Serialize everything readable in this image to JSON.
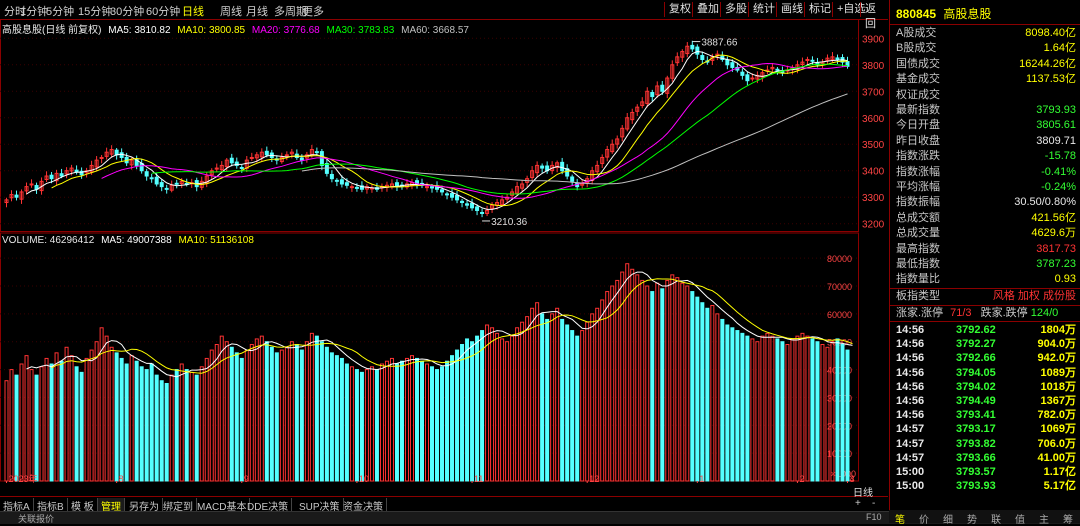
{
  "toolbar": {
    "periods": [
      "分时",
      "1分钟",
      "5分钟",
      "15分钟",
      "30分钟",
      "60分钟",
      "日线",
      "周线",
      "月线",
      "多周期",
      "更多"
    ],
    "active_period": "日线",
    "right_buttons": [
      "复权",
      "叠加",
      "多股",
      "统计",
      "画线",
      "标记",
      "+自选",
      "返回"
    ]
  },
  "price_legend": {
    "title": "高股息股(日线 前复权)",
    "ma5": "MA5: 3810.82",
    "ma10": "MA10: 3800.85",
    "ma20": "MA20: 3776.68",
    "ma30": "MA30: 3783.83",
    "ma60": "MA60: 3668.57"
  },
  "volume_legend": {
    "volume": "VOLUME: 46296412",
    "ma5": "MA5: 49007388",
    "ma10": "MA10: 51136108"
  },
  "colors": {
    "up": "#ff3333",
    "down": "#54ffff",
    "ma5": "#ffffff",
    "ma10": "#ffff00",
    "ma20": "#ff00ff",
    "ma30": "#00ff00",
    "ma60": "#c0c0c0",
    "frame": "#8b0000"
  },
  "chart_data": {
    "type": "candlestick",
    "price_axis": {
      "ticks": [
        3200,
        3300,
        3400,
        3500,
        3600,
        3700,
        3800,
        3900
      ],
      "ylim": [
        3180,
        3920
      ]
    },
    "volume_axis": {
      "ticks": [
        10000,
        20000,
        30000,
        40000,
        50000,
        60000,
        70000,
        80000
      ],
      "ylim": [
        0,
        84000
      ],
      "unit": "×1000"
    },
    "x_labels": [
      "2023年",
      "8",
      "9",
      "10",
      "11",
      "12",
      "1",
      "2",
      "3",
      "4"
    ],
    "annotations": [
      {
        "label": "3887.66",
        "x_index": 137,
        "value": 3887.66
      },
      {
        "label": "3210.36",
        "x_index": 95,
        "value": 3210.36
      }
    ],
    "close": [
      3290,
      3310,
      3300,
      3320,
      3340,
      3350,
      3330,
      3360,
      3380,
      3370,
      3390,
      3380,
      3400,
      3410,
      3395,
      3385,
      3400,
      3420,
      3440,
      3450,
      3470,
      3480,
      3460,
      3450,
      3430,
      3440,
      3420,
      3400,
      3380,
      3370,
      3350,
      3340,
      3330,
      3345,
      3350,
      3360,
      3350,
      3355,
      3340,
      3360,
      3380,
      3400,
      3410,
      3420,
      3440,
      3430,
      3420,
      3410,
      3440,
      3450,
      3460,
      3470,
      3460,
      3450,
      3440,
      3450,
      3460,
      3470,
      3450,
      3440,
      3460,
      3480,
      3470,
      3420,
      3390,
      3370,
      3360,
      3350,
      3345,
      3340,
      3335,
      3330,
      3340,
      3335,
      3330,
      3340,
      3345,
      3350,
      3340,
      3345,
      3350,
      3355,
      3350,
      3345,
      3340,
      3335,
      3330,
      3320,
      3310,
      3300,
      3290,
      3280,
      3270,
      3260,
      3250,
      3240,
      3250,
      3270,
      3280,
      3290,
      3300,
      3320,
      3340,
      3350,
      3370,
      3400,
      3420,
      3410,
      3400,
      3420,
      3430,
      3400,
      3380,
      3360,
      3340,
      3350,
      3370,
      3400,
      3420,
      3450,
      3480,
      3500,
      3520,
      3560,
      3600,
      3620,
      3640,
      3660,
      3700,
      3680,
      3720,
      3700,
      3750,
      3800,
      3830,
      3850,
      3870,
      3860,
      3840,
      3820,
      3810,
      3830,
      3840,
      3820,
      3800,
      3790,
      3780,
      3760,
      3740,
      3750,
      3760,
      3770,
      3780,
      3790,
      3780,
      3770,
      3780,
      3790,
      3800,
      3810,
      3820,
      3815,
      3800,
      3810,
      3825,
      3830,
      3820,
      3810,
      3794
    ],
    "volume": [
      36000,
      40000,
      38000,
      42000,
      45000,
      40000,
      38000,
      41000,
      44000,
      42000,
      46000,
      43000,
      48000,
      45000,
      41000,
      39000,
      44000,
      47000,
      50000,
      55000,
      52000,
      48000,
      46000,
      44000,
      42000,
      45000,
      43000,
      41000,
      40000,
      42000,
      38000,
      36000,
      35000,
      38000,
      40000,
      42000,
      40000,
      39000,
      38000,
      41000,
      44000,
      47000,
      49000,
      52000,
      50000,
      48000,
      46000,
      44000,
      47000,
      49000,
      51000,
      52000,
      50000,
      48000,
      46000,
      47000,
      48000,
      50000,
      49000,
      47000,
      50000,
      53000,
      52000,
      50000,
      48000,
      46000,
      45000,
      44000,
      42000,
      41000,
      40000,
      39000,
      40000,
      41000,
      40000,
      42000,
      43000,
      44000,
      42000,
      43000,
      44000,
      45000,
      44000,
      43000,
      42000,
      41000,
      40000,
      41000,
      43000,
      45000,
      47000,
      49000,
      51000,
      50000,
      52000,
      54000,
      56000,
      55000,
      53000,
      51000,
      50000,
      52000,
      55000,
      57000,
      59000,
      62000,
      64000,
      60000,
      58000,
      60000,
      62000,
      58000,
      56000,
      54000,
      52000,
      54000,
      57000,
      60000,
      62000,
      65000,
      68000,
      70000,
      72000,
      75000,
      78000,
      76000,
      74000,
      72000,
      70000,
      68000,
      71000,
      69000,
      72000,
      74000,
      73000,
      71000,
      70000,
      68000,
      66000,
      64000,
      62000,
      63000,
      60000,
      58000,
      56000,
      55000,
      54000,
      53000,
      52000,
      51000,
      50000,
      52000,
      53000,
      52000,
      51000,
      50000,
      49000,
      51000,
      52000,
      53000,
      52000,
      51000,
      50000,
      49000,
      48000,
      50000,
      51000,
      49000,
      47000,
      46296
    ]
  },
  "panel": {
    "code": "880845",
    "name": "高股息股",
    "stats": [
      {
        "k": "A股成交",
        "v": "8098.40亿",
        "c": "yellow"
      },
      {
        "k": "B股成交",
        "v": "1.64亿",
        "c": "yellow"
      },
      {
        "k": "国债成交",
        "v": "16244.26亿",
        "c": "yellow"
      },
      {
        "k": "基金成交",
        "v": "1137.53亿",
        "c": "yellow"
      },
      {
        "k": "权证成交",
        "v": "",
        "c": "yellow"
      },
      {
        "k": "最新指数",
        "v": "3793.93",
        "c": "green"
      },
      {
        "k": "今日开盘",
        "v": "3805.61",
        "c": "green"
      },
      {
        "k": "昨日收盘",
        "v": "3809.71",
        "c": "white"
      },
      {
        "k": "指数涨跌",
        "v": "-15.78",
        "c": "green"
      },
      {
        "k": "指数涨幅",
        "v": "-0.41%",
        "c": "green"
      },
      {
        "k": "平均涨幅",
        "v": "-0.24%",
        "c": "green"
      },
      {
        "k": "指数振幅",
        "v": "30.50/0.80%",
        "c": "white"
      },
      {
        "k": "总成交额",
        "v": "421.56亿",
        "c": "yellow"
      },
      {
        "k": "总成交量",
        "v": "4629.6万",
        "c": "yellow"
      },
      {
        "k": "最高指数",
        "v": "3817.73",
        "c": "red"
      },
      {
        "k": "最低指数",
        "v": "3787.23",
        "c": "green"
      },
      {
        "k": "指数量比",
        "v": "0.93",
        "c": "yellow"
      }
    ],
    "sector_type_label": "板指类型",
    "sector_type_value": "风格 加权 成份股",
    "rise_label": "涨家.涨停",
    "rise_value": "71/3",
    "fall_label": "跌家.跌停",
    "fall_value": "124/0",
    "ticks": [
      {
        "t": "14:56",
        "p": "3792.62",
        "q": "1804万",
        "c": "green"
      },
      {
        "t": "14:56",
        "p": "3792.27",
        "q": "904.0万",
        "c": "green"
      },
      {
        "t": "14:56",
        "p": "3792.66",
        "q": "942.0万",
        "c": "green"
      },
      {
        "t": "14:56",
        "p": "3794.05",
        "q": "1089万",
        "c": "green"
      },
      {
        "t": "14:56",
        "p": "3794.02",
        "q": "1018万",
        "c": "green"
      },
      {
        "t": "14:56",
        "p": "3794.49",
        "q": "1367万",
        "c": "green"
      },
      {
        "t": "14:56",
        "p": "3793.41",
        "q": "782.0万",
        "c": "green"
      },
      {
        "t": "14:57",
        "p": "3793.17",
        "q": "1069万",
        "c": "green"
      },
      {
        "t": "14:57",
        "p": "3793.82",
        "q": "706.0万",
        "c": "green"
      },
      {
        "t": "14:57",
        "p": "3793.66",
        "q": "41.00万",
        "c": "green"
      },
      {
        "t": "15:00",
        "p": "3793.57",
        "q": "1.17亿",
        "c": "green"
      },
      {
        "t": "15:00",
        "p": "3793.93",
        "q": "5.17亿",
        "c": "green"
      }
    ],
    "bottom_tabs": [
      "笔",
      "价",
      "细",
      "势",
      "联",
      "值",
      "主",
      "筹"
    ]
  },
  "bottom_tabs": [
    "指标A",
    "指标B",
    "模 板",
    "管理",
    "另存为",
    "绑定到",
    "MACD基本",
    "DDE决策",
    "SUP决策",
    "资金决策"
  ],
  "active_bottom_tab": "管理",
  "period_label": "日线",
  "status": {
    "left": "关联报价",
    "right": "F10"
  }
}
